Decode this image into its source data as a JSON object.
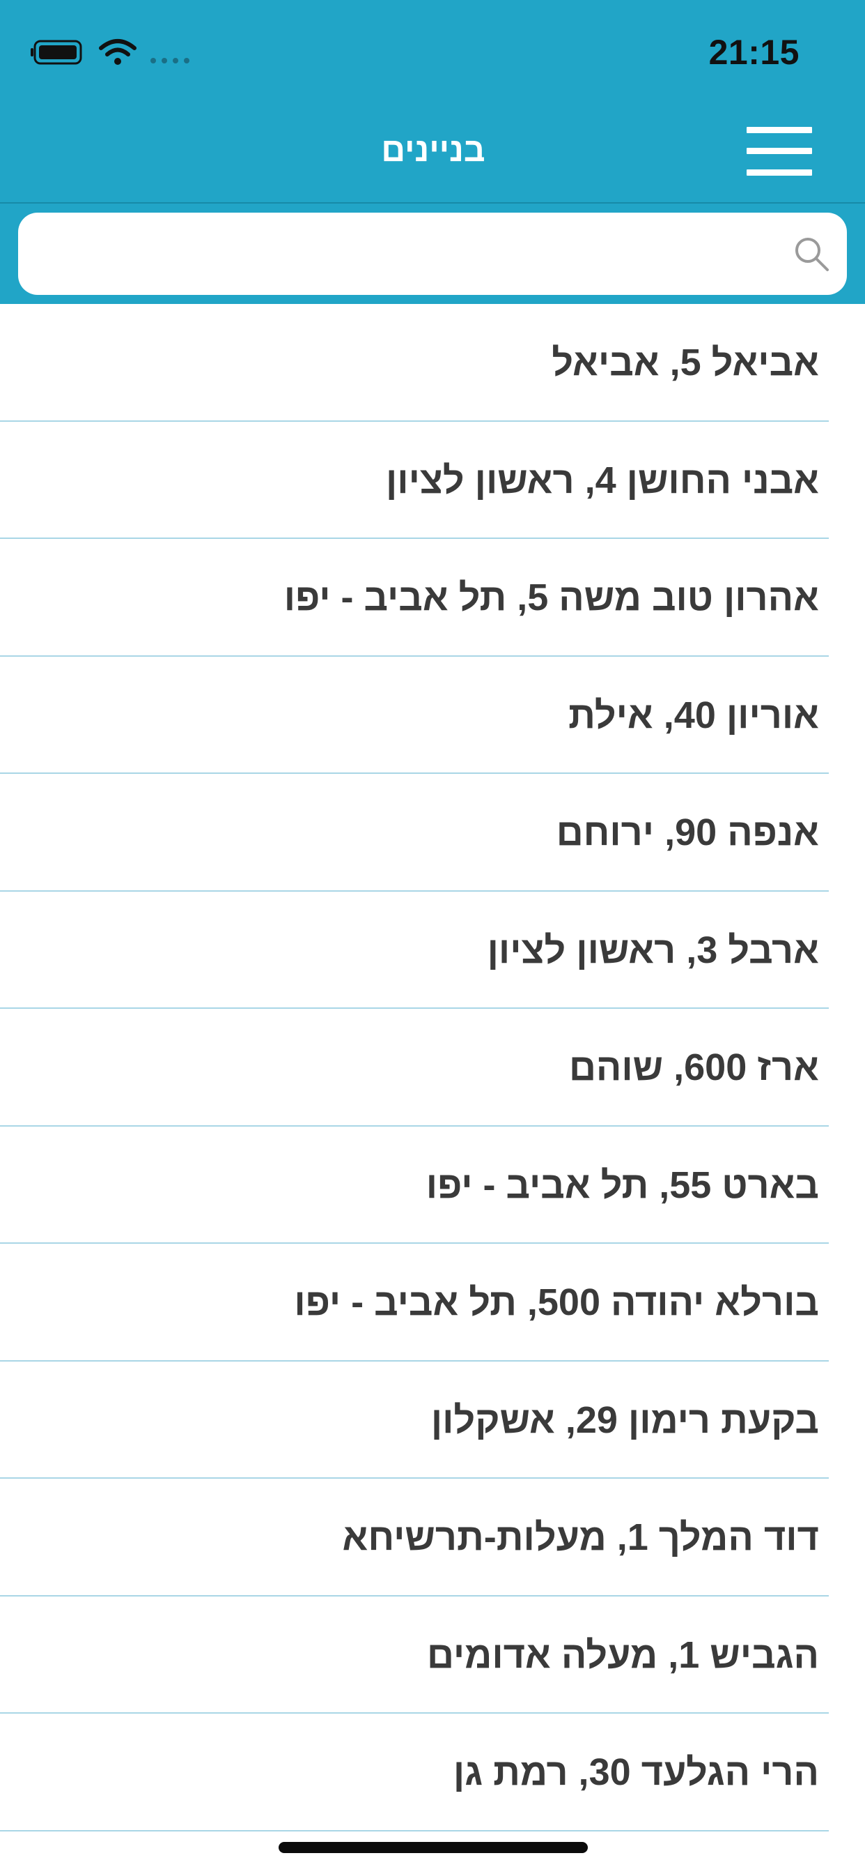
{
  "status_bar": {
    "time": "21:15",
    "icons": [
      "battery-icon",
      "wifi-icon",
      "signal-icon"
    ]
  },
  "header": {
    "title": "בניינים",
    "menu_icon": "hamburger-menu-icon"
  },
  "search": {
    "placeholder": "",
    "value": "",
    "icon": "search-icon"
  },
  "buildings": [
    {
      "label": "אביאל 5, אביאל"
    },
    {
      "label": "אבני החושן 4, ראשון לציון"
    },
    {
      "label": "אהרון טוב משה 5, תל אביב - יפו"
    },
    {
      "label": "אוריון 40, אילת"
    },
    {
      "label": "אנפה 90, ירוחם"
    },
    {
      "label": "ארבל 3, ראשון לציון"
    },
    {
      "label": "ארז 600, שוהם"
    },
    {
      "label": "בארט 55, תל אביב - יפו"
    },
    {
      "label": "בורלא יהודה 500, תל אביב - יפו"
    },
    {
      "label": "בקעת רימון 29, אשקלון"
    },
    {
      "label": "דוד המלך 1, מעלות-תרשיחא"
    },
    {
      "label": "הגביש 1, מעלה אדומים"
    },
    {
      "label": "הרי הגלעד 30, רמת גן"
    }
  ],
  "colors": {
    "header_bg": "#21a5c7",
    "separator": "#a9d6e6",
    "item_text": "#3a3a3a"
  }
}
